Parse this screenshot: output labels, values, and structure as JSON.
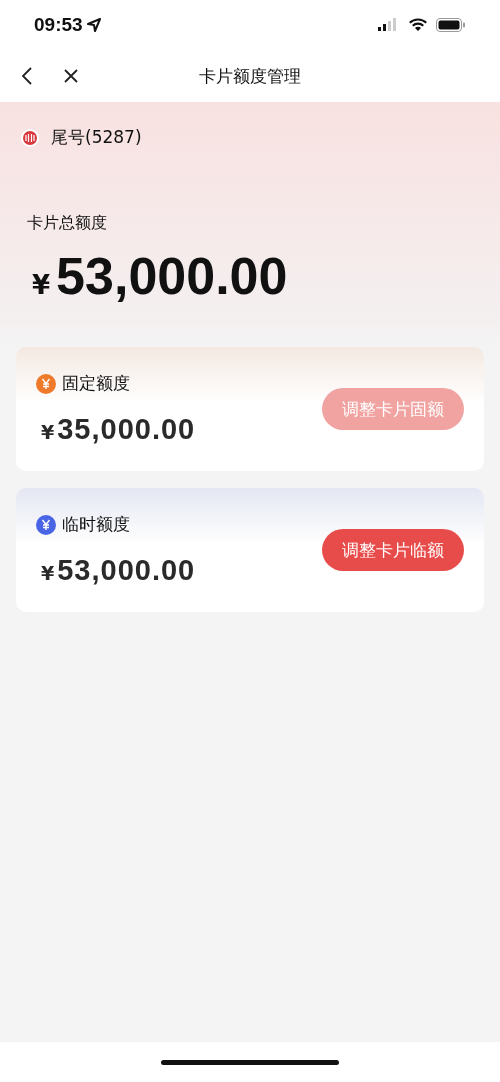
{
  "status_bar": {
    "time": "09:53"
  },
  "nav": {
    "title": "卡片额度管理"
  },
  "card": {
    "tail": "尾号(5287)",
    "total_label": "卡片总额度",
    "currency": "¥",
    "total": "53,000.00"
  },
  "limits": [
    {
      "title": "固定额度",
      "color": "#f07a2c",
      "currency": "¥",
      "amount": "35,000.00",
      "button": "调整卡片固额",
      "disabled": true
    },
    {
      "title": "临时额度",
      "color": "#4a64e6",
      "currency": "¥",
      "amount": "53,000.00",
      "button": "调整卡片临额",
      "disabled": false
    }
  ]
}
